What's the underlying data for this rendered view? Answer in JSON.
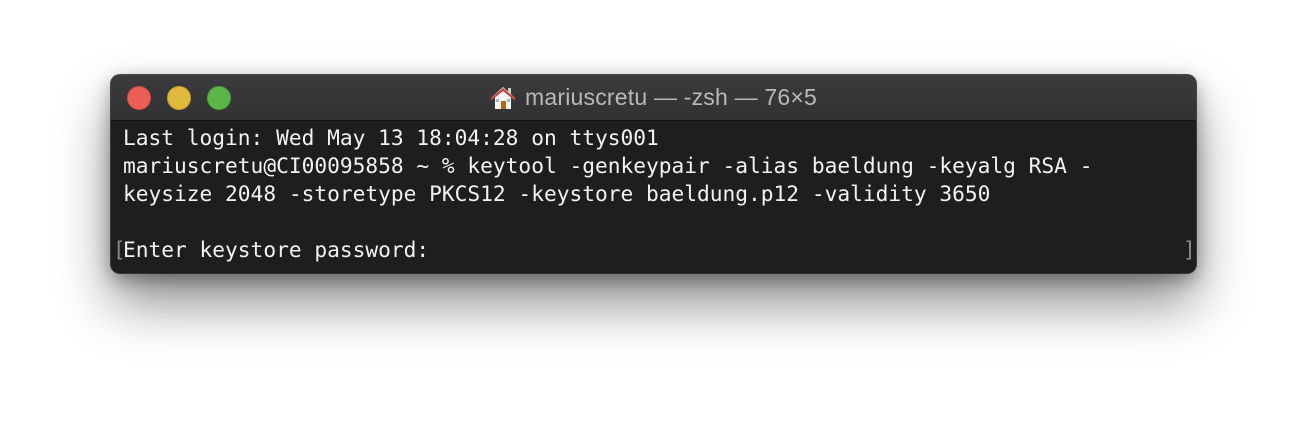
{
  "window": {
    "title": "mariuscretu — -zsh — 76×5",
    "traffic_lights": {
      "close": "#ec5f58",
      "minimize": "#dfba3c",
      "zoom": "#5ab747"
    },
    "title_icon": "home-folder-icon"
  },
  "terminal": {
    "lines": [
      "Last login: Wed May 13 18:04:28 on ttys001",
      "mariuscretu@CI00095858 ~ % keytool -genkeypair -alias baeldung -keyalg RSA -",
      "keysize 2048 -storetype PKCS12 -keystore baeldung.p12 -validity 3650",
      "Enter keystore password:"
    ],
    "marker_left": "[",
    "marker_right": "]",
    "background": "#1e1e1e",
    "foreground": "#f2f2f2"
  }
}
